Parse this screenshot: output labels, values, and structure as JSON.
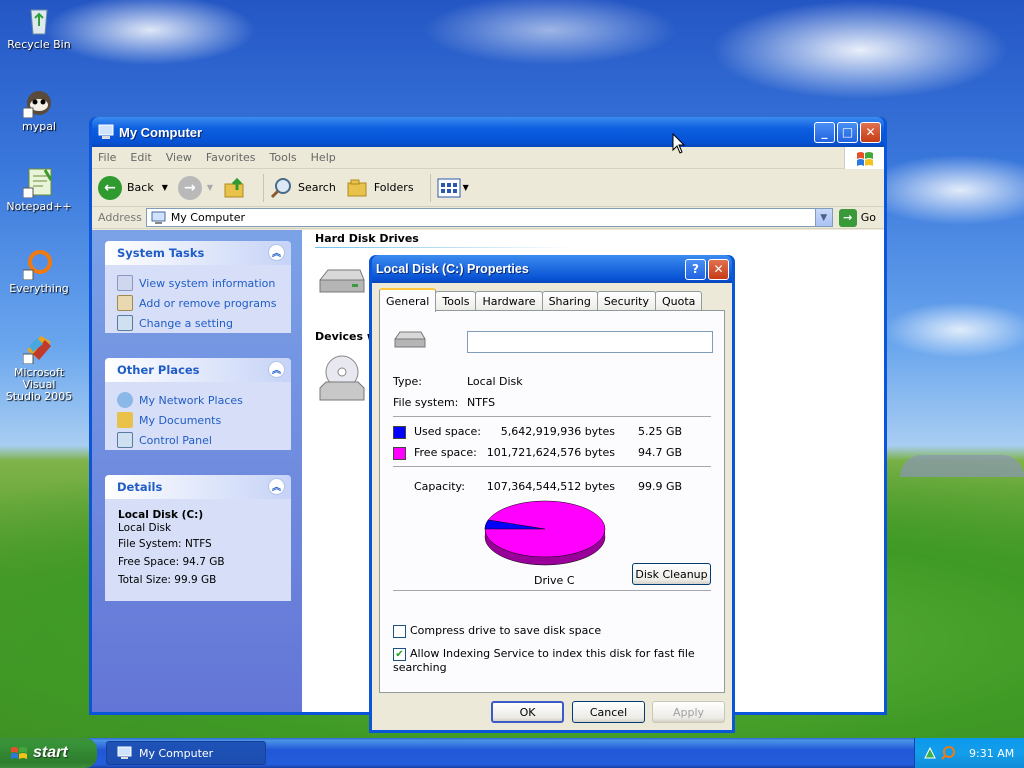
{
  "desktop": {
    "icons": [
      {
        "label": "Recycle Bin",
        "icon": "recycle-bin-icon"
      },
      {
        "label": "mypal",
        "icon": "raccoon-icon"
      },
      {
        "label": "Notepad++",
        "icon": "notepad-icon"
      },
      {
        "label": "Everything",
        "icon": "search-ring-icon"
      },
      {
        "label": "Microsoft Visual Studio 2005",
        "icon": "visual-studio-icon"
      }
    ]
  },
  "window": {
    "title": "My Computer",
    "menu": [
      "File",
      "Edit",
      "View",
      "Favorites",
      "Tools",
      "Help"
    ],
    "toolbar": {
      "back": "Back",
      "search": "Search",
      "folders": "Folders"
    },
    "address": {
      "label": "Address",
      "value": "My Computer",
      "go": "Go"
    },
    "system_tasks": {
      "title": "System Tasks",
      "items": [
        "View system information",
        "Add or remove programs",
        "Change a setting"
      ]
    },
    "other_places": {
      "title": "Other Places",
      "items": [
        "My Network Places",
        "My Documents",
        "Control Panel"
      ]
    },
    "details": {
      "title": "Details",
      "name": "Local Disk (C:)",
      "type": "Local Disk",
      "fs": "File System: NTFS",
      "free": "Free Space: 94.7 GB",
      "total": "Total Size: 99.9 GB"
    },
    "sections": {
      "hdd": "Hard Disk Drives",
      "devices": "Devices w"
    }
  },
  "dialog": {
    "title": "Local Disk (C:) Properties",
    "tabs": [
      "General",
      "Tools",
      "Hardware",
      "Sharing",
      "Security",
      "Quota"
    ],
    "active_tab": "General",
    "name_value": "",
    "type_label": "Type:",
    "type_value": "Local Disk",
    "fs_label": "File system:",
    "fs_value": "NTFS",
    "used_label": "Used space:",
    "used_bytes": "5,642,919,936 bytes",
    "used_gb": "5.25 GB",
    "free_label": "Free space:",
    "free_bytes": "101,721,624,576 bytes",
    "free_gb": "94.7 GB",
    "cap_label": "Capacity:",
    "cap_bytes": "107,364,544,512 bytes",
    "cap_gb": "99.9 GB",
    "drive_label": "Drive C",
    "cleanup": "Disk Cleanup",
    "compress": "Compress drive to save disk space",
    "indexing": "Allow Indexing Service to index this disk for fast file searching",
    "ok": "OK",
    "cancel": "Cancel",
    "apply": "Apply",
    "used_color": "#0000ff",
    "free_color": "#ff00ff",
    "used_fraction": 0.0526
  },
  "taskbar": {
    "start": "start",
    "task": "My Computer",
    "clock": "9:31 AM"
  }
}
